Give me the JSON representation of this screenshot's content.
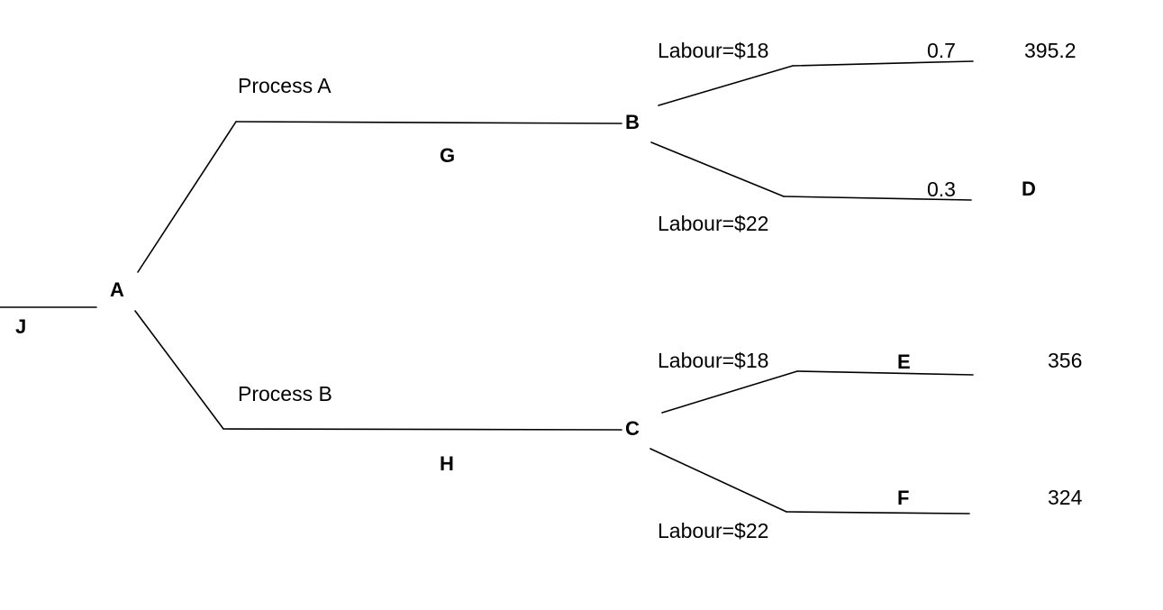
{
  "diagram": {
    "type": "decision-tree",
    "title": "",
    "line_color": "#000000",
    "background": "#ffffff"
  },
  "nodes": {
    "root_label": "J",
    "decision": "A",
    "chance_upper": "B",
    "chance_lower": "C"
  },
  "branches": {
    "process_a": "Process A",
    "process_b": "Process B",
    "payoff_g": "G",
    "payoff_h": "H"
  },
  "upper": {
    "labour_high_label": "Labour=$18",
    "labour_low_label": "Labour=$22",
    "prob_high": "0.7",
    "prob_low": "0.3",
    "outcome_high_value": "395.2",
    "outcome_low_label": "D"
  },
  "lower": {
    "labour_high_label": "Labour=$18",
    "labour_low_label": "Labour=$22",
    "outcome_high_label": "E",
    "outcome_low_label": "F",
    "outcome_high_value": "356",
    "outcome_low_value": "324"
  }
}
